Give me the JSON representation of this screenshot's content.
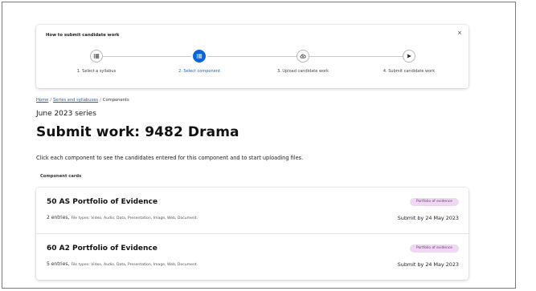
{
  "steps_panel": {
    "title": "How to submit candidate work",
    "close_label": "×",
    "steps": [
      {
        "label": "1. Select a syllabus",
        "icon": "list-icon",
        "active": false
      },
      {
        "label": "2. Select component",
        "icon": "list-icon",
        "active": true
      },
      {
        "label": "3. Upload candidate work",
        "icon": "cloud-upload-icon",
        "active": false
      },
      {
        "label": "4. Submit candidate work",
        "icon": "send-icon",
        "active": false
      }
    ]
  },
  "breadcrumb": {
    "home": "Home",
    "series": "Series and syllabuses",
    "current": "Components",
    "separator": "/"
  },
  "series_label": "June 2023 series",
  "page_title": "Submit work: 9482 Drama",
  "intro_text": "Click each component to see the candidates entered for this component and to start uploading files.",
  "cards_heading": "Component cards",
  "cards": [
    {
      "title": "50 AS Portfolio of Evidence",
      "entries": "2 entries,",
      "file_types": "File types: Video, Audio, Data, Presentation, Image, Web, Document.",
      "badge": "Portfolio of evidence",
      "deadline": "Submit by 24 May 2023"
    },
    {
      "title": "60 A2 Portfolio of Evidence",
      "entries": "5 entries,",
      "file_types": "File types: Video, Audio, Data, Presentation, Image, Web, Document.",
      "badge": "Portfolio of evidence",
      "deadline": "Submit by 24 May 2023"
    }
  ],
  "colors": {
    "accent": "#0a66d6",
    "link": "#1a5fb4",
    "badge_bg": "#efd9f2",
    "badge_text": "#7b2a87"
  }
}
